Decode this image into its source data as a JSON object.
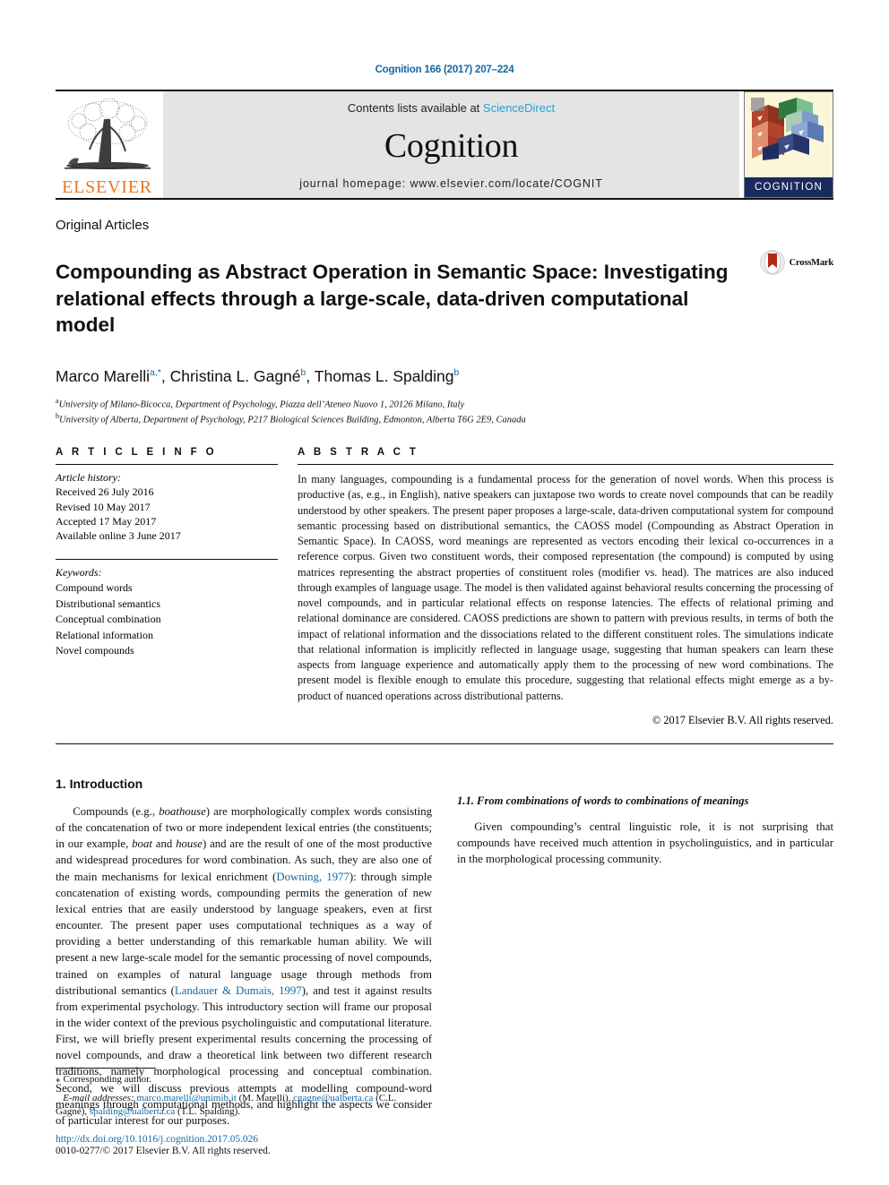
{
  "running_head": "Cognition 166 (2017) 207–224",
  "masthead": {
    "contents_prefix": "Contents lists available at ",
    "contents_link": "ScienceDirect",
    "journal_name": "Cognition",
    "homepage": "journal homepage: www.elsevier.com/locate/COGNIT",
    "publisher_name": "ELSEVIER",
    "cover_label": "COGNITION",
    "publisher_logo_icon": "elsevier-tree-icon",
    "cover_icon": "cognition-journal-cover-icon"
  },
  "article": {
    "section_kind": "Original Articles",
    "title": "Compounding as Abstract Operation in Semantic Space: Investigating relational effects through a large-scale, data-driven computational model",
    "crossmark_label": "CrossMark",
    "crossmark_icon": "crossmark-badge-icon",
    "authors": [
      {
        "name": "Marco Marelli",
        "sup": "a,*"
      },
      {
        "name": "Christina L. Gagné",
        "sup": "b"
      },
      {
        "name": "Thomas L. Spalding",
        "sup": "b"
      }
    ],
    "affiliations": [
      {
        "marker": "a",
        "text": "University of Milano-Bicocca, Department of Psychology, Piazza dell’Ateneo Nuovo 1, 20126 Milano, Italy"
      },
      {
        "marker": "b",
        "text": "University of Alberta, Department of Psychology, P217 Biological Sciences Building, Edmonton, Alberta T6G 2E9, Canada"
      }
    ]
  },
  "info": {
    "heading": "A R T I C L E   I N F O",
    "history_label": "Article history:",
    "history": [
      "Received 26 July 2016",
      "Revised 10 May 2017",
      "Accepted 17 May 2017",
      "Available online 3 June 2017"
    ],
    "keywords_label": "Keywords:",
    "keywords": [
      "Compound words",
      "Distributional semantics",
      "Conceptual combination",
      "Relational information",
      "Novel compounds"
    ]
  },
  "abstract": {
    "heading": "A B S T R A C T",
    "text": "In many languages, compounding is a fundamental process for the generation of novel words. When this process is productive (as, e.g., in English), native speakers can juxtapose two words to create novel compounds that can be readily understood by other speakers. The present paper proposes a large-scale, data-driven computational system for compound semantic processing based on distributional semantics, the CAOSS model (Compounding as Abstract Operation in Semantic Space). In CAOSS, word meanings are represented as vectors encoding their lexical co-occurrences in a reference corpus. Given two constituent words, their composed representation (the compound) is computed by using matrices representing the abstract properties of constituent roles (modifier vs. head). The matrices are also induced through examples of language usage. The model is then validated against behavioral results concerning the processing of novel compounds, and in particular relational effects on response latencies. The effects of relational priming and relational dominance are considered. CAOSS predictions are shown to pattern with previous results, in terms of both the impact of relational information and the dissociations related to the different constituent roles. The simulations indicate that relational information is implicitly reflected in language usage, suggesting that human speakers can learn these aspects from language experience and automatically apply them to the processing of new word combinations. The present model is flexible enough to emulate this procedure, suggesting that relational effects might emerge as a by-product of nuanced operations across distributional patterns.",
    "copyright": "© 2017 Elsevier B.V. All rights reserved."
  },
  "body": {
    "intro_heading": "1. Introduction",
    "intro_p1_a": "Compounds (e.g., ",
    "intro_p1_em1": "boathouse",
    "intro_p1_b": ") are morphologically complex words consisting of the concatenation of two or more independent lexical entries (the constituents; in our example, ",
    "intro_p1_em2": "boat",
    "intro_p1_c": " and ",
    "intro_p1_em3": "house",
    "intro_p1_d": ") and are the result of one of the most productive and widespread procedures for word combination. As such, they are also one of the main mechanisms for lexical enrichment (",
    "intro_p1_ref": "Downing, 1977",
    "intro_p1_e": "): through simple concatenation of existing words, compounding permits the generation of new lexical entries that are easily understood by language speakers, even at first encounter. The present paper uses computational techniques as a way of providing a better understanding of this remarkable human ability. We will present a new large-scale model for the semantic processing of novel compounds, trained on examples of natural language usage through methods from distributional semantics (",
    "intro_p1_ref2": "Landauer & Dumais, 1997",
    "intro_p1_f": "), and test it against results from experimental psychology. This introductory section will frame our proposal in the wider context of the previous psycholinguistic and computational literature. First, we will briefly present experimental results concerning the processing of novel compounds, and draw a theoretical link between two different research traditions, namely morphological processing and conceptual combination. Second, we will discuss previous attempts at modelling compound-word meanings through computational methods, and highlight the aspects we consider of particular interest for our purposes.",
    "sub_heading": "1.1. From combinations of words to combinations of meanings",
    "sub_p1": "Given compounding’s central linguistic role, it is not surprising that compounds have received much attention in psycholinguistics, and in particular in the morphological processing community."
  },
  "footnote": {
    "corresponding_marker": "⁎",
    "corresponding": "Corresponding author.",
    "email_label": "E-mail addresses:",
    "emails": [
      {
        "address": "marco.marelli@unimib.it",
        "owner": "(M. Marelli)"
      },
      {
        "address": "cgagne@ualberta.ca",
        "owner": "(C.L. Gagné)"
      },
      {
        "address": "spalding@ualberta.ca",
        "owner": "(T.L. Spalding)"
      }
    ],
    "doi": "http://dx.doi.org/10.1016/j.cognition.2017.05.026",
    "issn_line": "0010-0277/© 2017 Elsevier B.V. All rights reserved."
  },
  "colors": {
    "link_blue": "#1368a1",
    "sd_blue": "#2a9fd0",
    "elsevier_orange": "#e87722",
    "panel_gray": "#e4e4e4",
    "cover_navy": "#1b2a5e"
  }
}
